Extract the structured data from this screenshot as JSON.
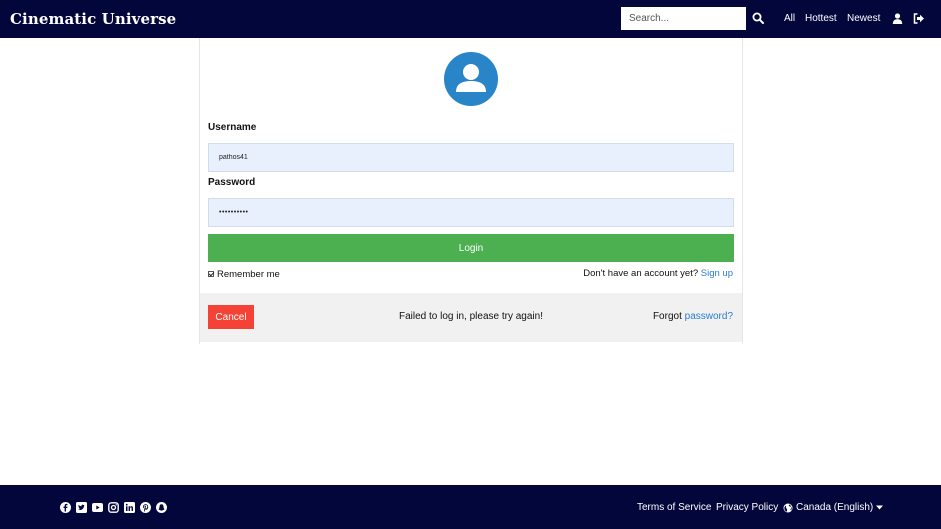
{
  "header": {
    "brand": "Cinematic Universe",
    "search_placeholder": "Search...",
    "nav": {
      "all": "All",
      "hottest": "Hottest",
      "newest": "Newest"
    }
  },
  "login": {
    "username_label": "Username",
    "username_value": "pathos41",
    "password_label": "Password",
    "password_value": "••••••••••",
    "login_button": "Login",
    "remember_me": "Remember me",
    "no_account": "Don't have an account yet?",
    "sign_up": "Sign up",
    "cancel_button": "Cancel",
    "error_message": "Failed to log in, please try again!",
    "forgot_prefix": "Forgot",
    "forgot_link": "password?"
  },
  "footer": {
    "social_icons": [
      "facebook-icon",
      "twitter-icon",
      "youtube-icon",
      "instagram-icon",
      "linkedin-icon",
      "pinterest-icon",
      "snapchat-icon"
    ],
    "terms": "Terms of Service",
    "privacy": "Privacy Policy",
    "language": "Canada (English)"
  },
  "colors": {
    "header_bg": "#03063b",
    "login_button": "#4caf50",
    "cancel_button": "#f44336",
    "avatar": "#2a85c8",
    "link": "#2a7dd1",
    "input_bg": "#e8f0fe"
  }
}
